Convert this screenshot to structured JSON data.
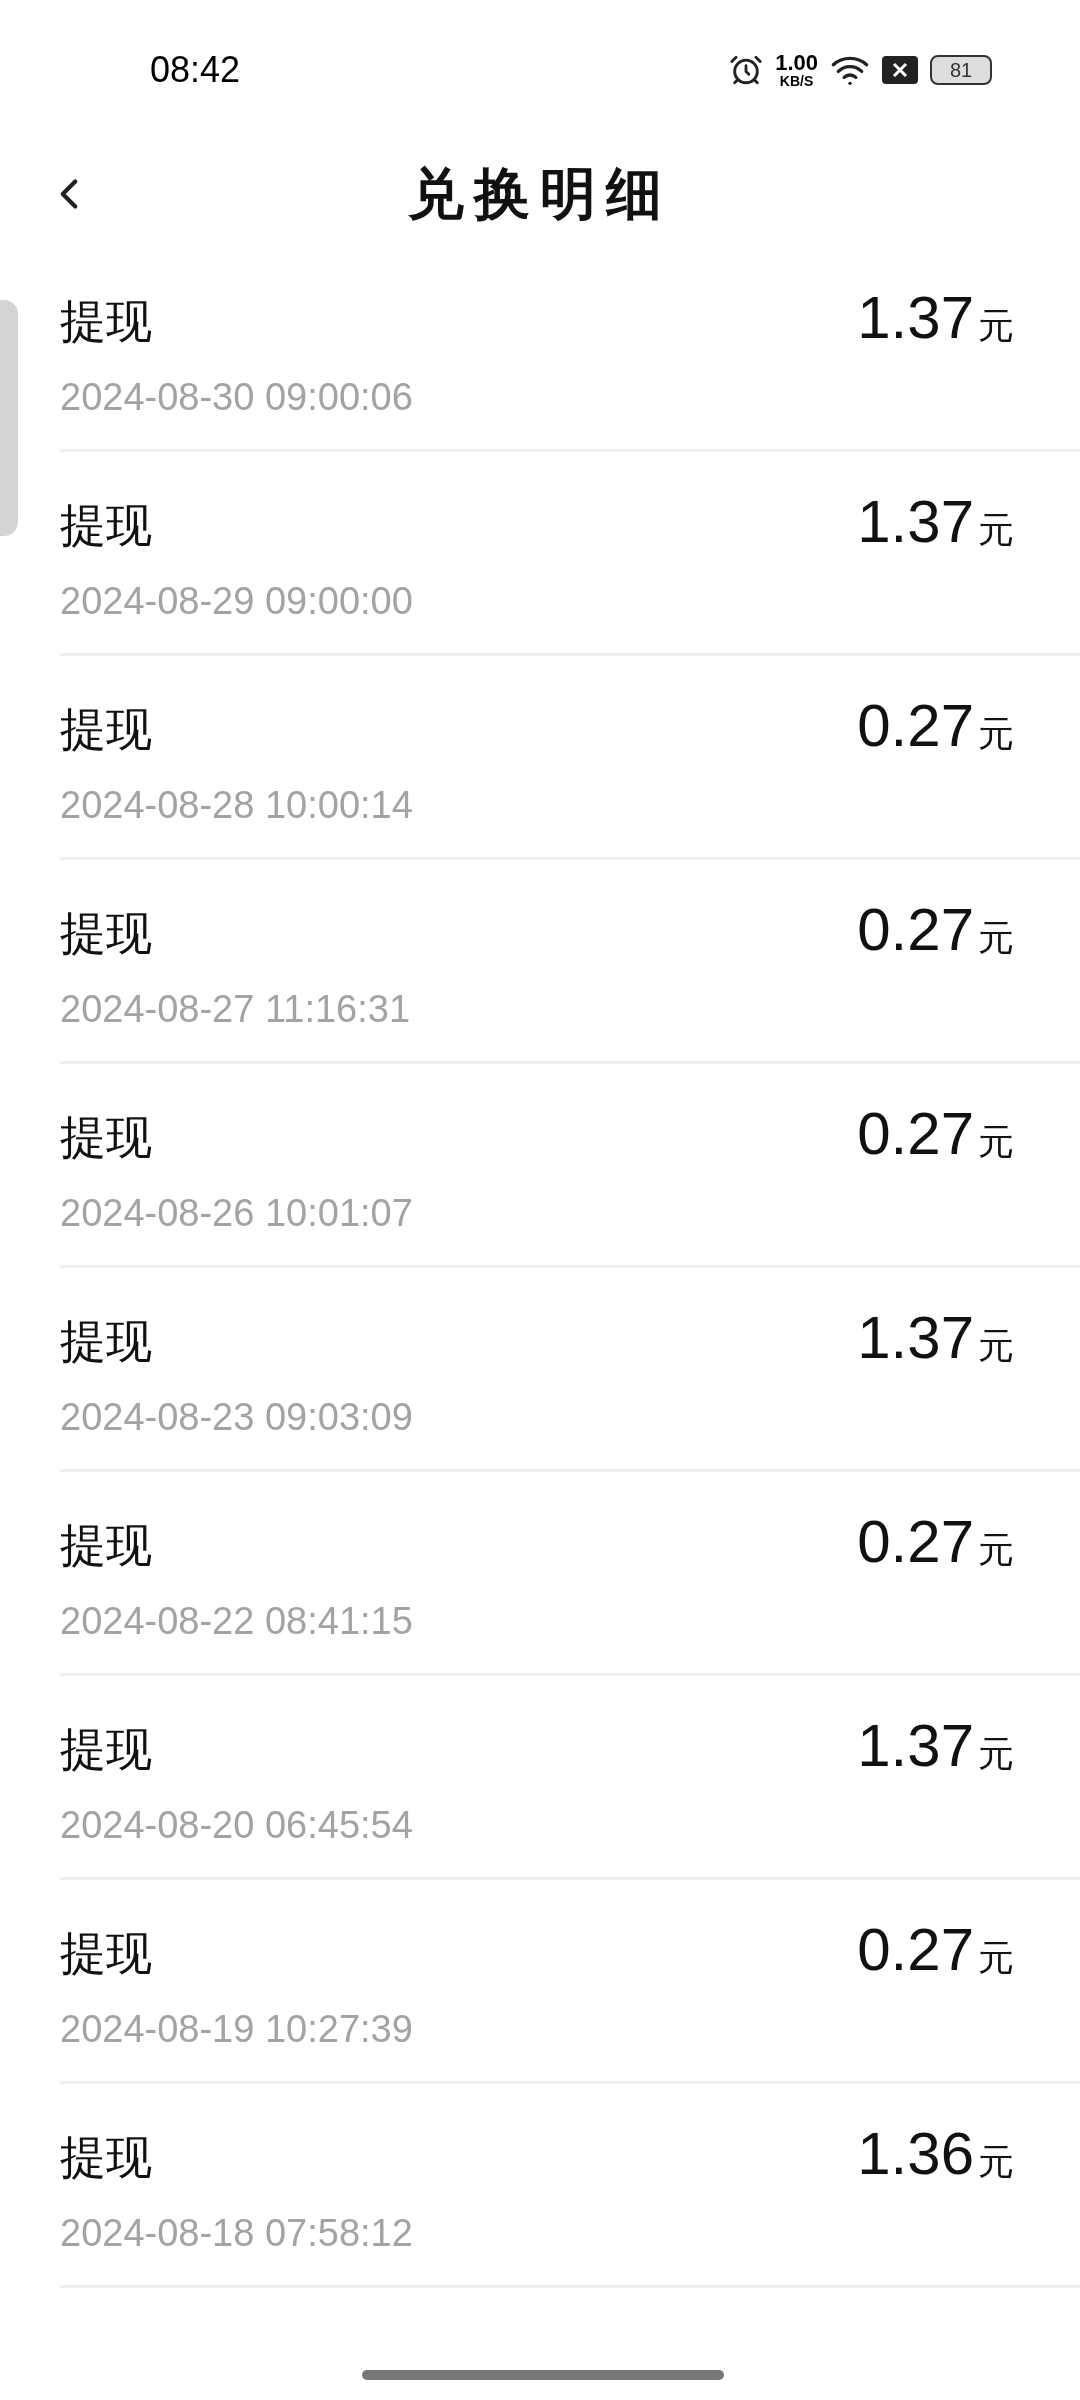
{
  "status_bar": {
    "time": "08:42",
    "net_speed": "1.00",
    "net_unit": "KB/S",
    "battery": "81"
  },
  "header": {
    "title": "兑换明细"
  },
  "records": [
    {
      "label": "提现",
      "time": "2024-08-30 09:00:06",
      "amount": "1.37",
      "unit": "元"
    },
    {
      "label": "提现",
      "time": "2024-08-29 09:00:00",
      "amount": "1.37",
      "unit": "元"
    },
    {
      "label": "提现",
      "time": "2024-08-28 10:00:14",
      "amount": "0.27",
      "unit": "元"
    },
    {
      "label": "提现",
      "time": "2024-08-27 11:16:31",
      "amount": "0.27",
      "unit": "元"
    },
    {
      "label": "提现",
      "time": "2024-08-26 10:01:07",
      "amount": "0.27",
      "unit": "元"
    },
    {
      "label": "提现",
      "time": "2024-08-23 09:03:09",
      "amount": "1.37",
      "unit": "元"
    },
    {
      "label": "提现",
      "time": "2024-08-22 08:41:15",
      "amount": "0.27",
      "unit": "元"
    },
    {
      "label": "提现",
      "time": "2024-08-20 06:45:54",
      "amount": "1.37",
      "unit": "元"
    },
    {
      "label": "提现",
      "time": "2024-08-19 10:27:39",
      "amount": "0.27",
      "unit": "元"
    },
    {
      "label": "提现",
      "time": "2024-08-18 07:58:12",
      "amount": "1.36",
      "unit": "元"
    }
  ]
}
